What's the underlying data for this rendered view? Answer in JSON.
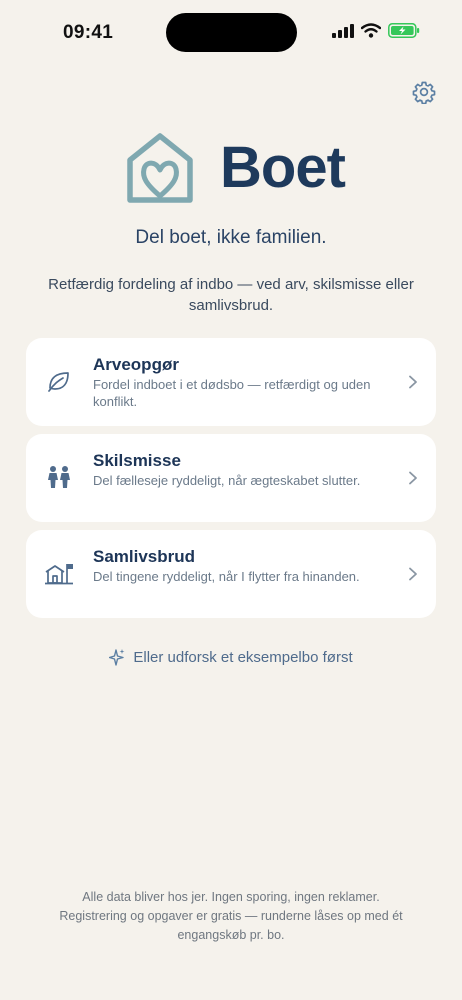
{
  "status": {
    "time": "09:41"
  },
  "app": {
    "name": "Boet"
  },
  "tagline": "Del boet, ikke familien.",
  "subtitle": "Retfærdig fordeling af indbo — ved arv, skilsmisse eller samlivsbrud.",
  "cards": [
    {
      "title": "Arveopgør",
      "desc": "Fordel indboet i et dødsbo — retfærdigt og uden konflikt.",
      "icon": "leaf-icon"
    },
    {
      "title": "Skilsmisse",
      "desc": "Del fælleseje ryddeligt, når ægteskabet slutter.",
      "icon": "people-icon"
    },
    {
      "title": "Samlivsbrud",
      "desc": "Del tingene ryddeligt, når I flytter fra hinanden.",
      "icon": "house-flag-icon"
    }
  ],
  "explore": {
    "label": "Eller udforsk et eksempelbo først",
    "icon": "sparkle-icon"
  },
  "footer": {
    "line1": "Alle data bliver hos jer. Ingen sporing, ingen reklamer.",
    "line2": "Registrering og opgaver er gratis — runderne låses op med ét engangskøb pr. bo."
  },
  "colors": {
    "background": "#f5f2ec",
    "brand": "#1e3a5c",
    "logo_teal": "#7fa8b0",
    "battery": "#34c759"
  }
}
